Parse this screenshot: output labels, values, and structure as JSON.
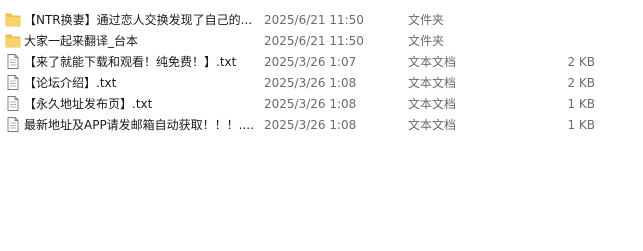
{
  "colors": {
    "folder": "#f3c64c",
    "folder_dark": "#e0ac2b",
    "file_border": "#7a7a7a",
    "text": "#1a1a1a",
    "muted": "#6b6b6b"
  },
  "files": [
    {
      "icon": "folder-icon",
      "name": "【NTR换妻】通过恋人交换发现了自己的...",
      "modified": "2025/6/21 11:50",
      "type": "文件夹",
      "size": ""
    },
    {
      "icon": "folder-icon",
      "name": "大家一起来翻译_台本",
      "modified": "2025/6/21 11:50",
      "type": "文件夹",
      "size": ""
    },
    {
      "icon": "text-file-icon",
      "name": "【来了就能下载和观看！纯免费！】.txt",
      "modified": "2025/3/26 1:07",
      "type": "文本文档",
      "size": "2 KB"
    },
    {
      "icon": "text-file-icon",
      "name": "【论坛介绍】.txt",
      "modified": "2025/3/26 1:08",
      "type": "文本文档",
      "size": "2 KB"
    },
    {
      "icon": "text-file-icon",
      "name": "【永久地址发布页】.txt",
      "modified": "2025/3/26 1:08",
      "type": "文本文档",
      "size": "1 KB"
    },
    {
      "icon": "text-file-icon",
      "name": "最新地址及APP请发邮箱自动获取！！！....",
      "modified": "2025/3/26 1:08",
      "type": "文本文档",
      "size": "1 KB"
    }
  ]
}
